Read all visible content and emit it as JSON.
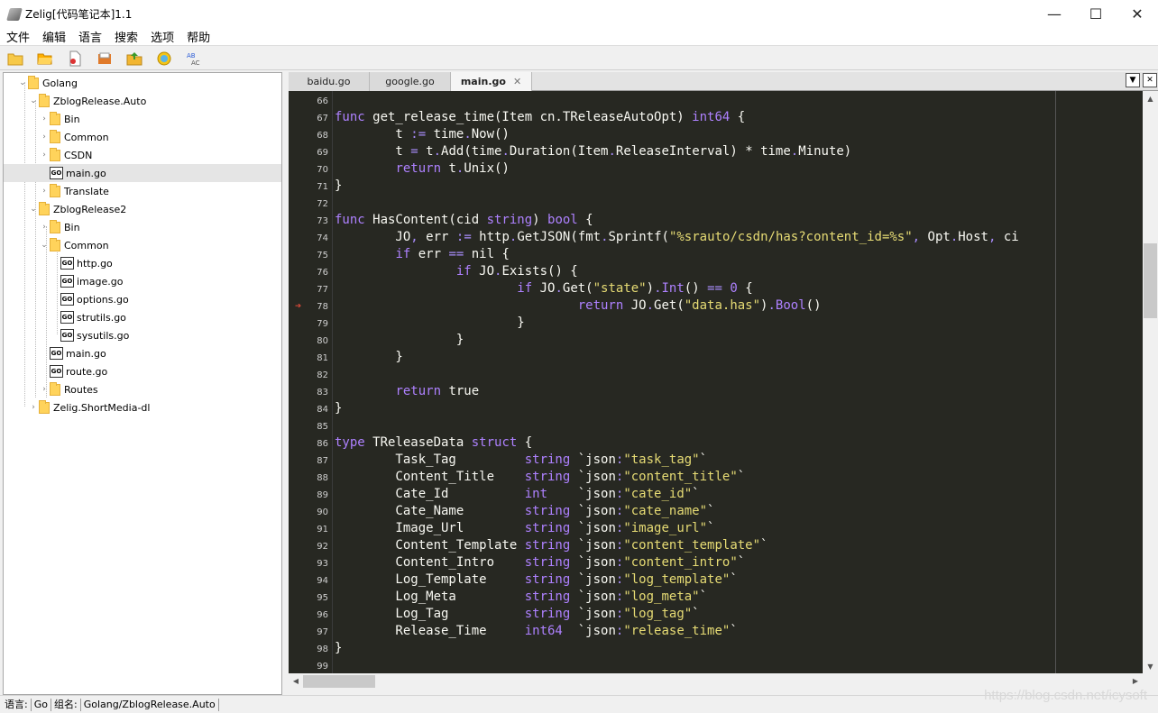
{
  "window": {
    "title": "Zelig[代码笔记本]1.1",
    "minimize": "—",
    "maximize": "☐",
    "close": "✕"
  },
  "menu": [
    "文件",
    "编辑",
    "语言",
    "搜索",
    "选项",
    "帮助"
  ],
  "toolbar_icons": [
    "new-folder-icon",
    "open-folder-icon",
    "document-icon",
    "save-icon",
    "folder-up-icon",
    "settings-icon",
    "spellcheck-icon"
  ],
  "tree": [
    {
      "label": "Golang",
      "icon": "folder",
      "depth": 0,
      "caret": "⌄"
    },
    {
      "label": "ZblogRelease.Auto",
      "icon": "folder",
      "depth": 1,
      "caret": "⌄"
    },
    {
      "label": "Bin",
      "icon": "folder",
      "depth": 2,
      "caret": "›"
    },
    {
      "label": "Common",
      "icon": "folder",
      "depth": 2,
      "caret": "›"
    },
    {
      "label": "CSDN",
      "icon": "folder",
      "depth": 2,
      "caret": "›"
    },
    {
      "label": "main.go",
      "icon": "go",
      "depth": 2,
      "caret": "",
      "selected": true
    },
    {
      "label": "Translate",
      "icon": "folder",
      "depth": 2,
      "caret": "›"
    },
    {
      "label": "ZblogRelease2",
      "icon": "folder",
      "depth": 1,
      "caret": "⌄"
    },
    {
      "label": "Bin",
      "icon": "folder",
      "depth": 2,
      "caret": "›"
    },
    {
      "label": "Common",
      "icon": "folder",
      "depth": 2,
      "caret": "⌄"
    },
    {
      "label": "http.go",
      "icon": "go",
      "depth": 3,
      "caret": ""
    },
    {
      "label": "image.go",
      "icon": "go",
      "depth": 3,
      "caret": ""
    },
    {
      "label": "options.go",
      "icon": "go",
      "depth": 3,
      "caret": ""
    },
    {
      "label": "strutils.go",
      "icon": "go",
      "depth": 3,
      "caret": ""
    },
    {
      "label": "sysutils.go",
      "icon": "go",
      "depth": 3,
      "caret": ""
    },
    {
      "label": "main.go",
      "icon": "go",
      "depth": 2,
      "caret": ""
    },
    {
      "label": "route.go",
      "icon": "go",
      "depth": 2,
      "caret": ""
    },
    {
      "label": "Routes",
      "icon": "folder",
      "depth": 2,
      "caret": "›"
    },
    {
      "label": "Zelig.ShortMedia-dl",
      "icon": "folder",
      "depth": 1,
      "caret": "›"
    }
  ],
  "go_icon_text": "GO",
  "tabs": [
    {
      "label": "baidu.go",
      "active": false
    },
    {
      "label": "google.go",
      "active": false
    },
    {
      "label": "main.go",
      "active": true,
      "close": "✕"
    }
  ],
  "tab_controls": {
    "dropdown": "▼",
    "close": "✕"
  },
  "breakpoint_arrow": "➔",
  "code": [
    {
      "n": "66",
      "t": [
        {
          "c": ""
        }
      ]
    },
    {
      "n": "67",
      "t": [
        {
          "k": "kw",
          "c": "func"
        },
        {
          "c": " get_release_time(Item cn."
        },
        {
          "c": "TReleaseAutoOpt) "
        },
        {
          "k": "kw",
          "c": "int64"
        },
        {
          "c": " {"
        }
      ]
    },
    {
      "n": "68",
      "t": [
        {
          "c": "        t "
        },
        {
          "k": "op",
          "c": ":="
        },
        {
          "c": " time"
        },
        {
          "k": "op",
          "c": "."
        },
        {
          "c": "Now()"
        }
      ]
    },
    {
      "n": "69",
      "t": [
        {
          "c": "        t "
        },
        {
          "k": "op",
          "c": "="
        },
        {
          "c": " t"
        },
        {
          "k": "op",
          "c": "."
        },
        {
          "c": "Add(time"
        },
        {
          "k": "op",
          "c": "."
        },
        {
          "c": "Duration(Item"
        },
        {
          "k": "op",
          "c": "."
        },
        {
          "c": "ReleaseInterval) * time"
        },
        {
          "k": "op",
          "c": "."
        },
        {
          "c": "Minute)"
        }
      ]
    },
    {
      "n": "70",
      "t": [
        {
          "c": "        "
        },
        {
          "k": "kw",
          "c": "return"
        },
        {
          "c": " t"
        },
        {
          "k": "op",
          "c": "."
        },
        {
          "c": "Unix()"
        }
      ]
    },
    {
      "n": "71",
      "t": [
        {
          "c": "}"
        }
      ]
    },
    {
      "n": "72",
      "t": [
        {
          "c": ""
        }
      ]
    },
    {
      "n": "73",
      "t": [
        {
          "k": "kw",
          "c": "func"
        },
        {
          "c": " HasContent(cid "
        },
        {
          "k": "kw",
          "c": "string"
        },
        {
          "c": ") "
        },
        {
          "k": "kw",
          "c": "bool"
        },
        {
          "c": " {"
        }
      ]
    },
    {
      "n": "74",
      "t": [
        {
          "c": "        JO"
        },
        {
          "k": "op",
          "c": ","
        },
        {
          "c": " err "
        },
        {
          "k": "op",
          "c": ":="
        },
        {
          "c": " http"
        },
        {
          "k": "op",
          "c": "."
        },
        {
          "c": "GetJSON(fmt"
        },
        {
          "k": "op",
          "c": "."
        },
        {
          "c": "Sprintf("
        },
        {
          "k": "str",
          "c": "\"%srauto/csdn/has?content_id=%s\""
        },
        {
          "k": "op",
          "c": ","
        },
        {
          "c": " Opt"
        },
        {
          "k": "op",
          "c": "."
        },
        {
          "c": "Host"
        },
        {
          "k": "op",
          "c": ","
        },
        {
          "c": " ci"
        }
      ]
    },
    {
      "n": "75",
      "t": [
        {
          "c": "        "
        },
        {
          "k": "kw",
          "c": "if"
        },
        {
          "c": " err "
        },
        {
          "k": "op",
          "c": "=="
        },
        {
          "c": " nil {"
        }
      ]
    },
    {
      "n": "76",
      "t": [
        {
          "c": "                "
        },
        {
          "k": "kw",
          "c": "if"
        },
        {
          "c": " JO"
        },
        {
          "k": "op",
          "c": "."
        },
        {
          "c": "Exists() {"
        }
      ]
    },
    {
      "n": "77",
      "t": [
        {
          "c": "                        "
        },
        {
          "k": "kw",
          "c": "if"
        },
        {
          "c": " JO"
        },
        {
          "k": "op",
          "c": "."
        },
        {
          "c": "Get("
        },
        {
          "k": "str",
          "c": "\"state\""
        },
        {
          "c": ")"
        },
        {
          "k": "op",
          "c": "."
        },
        {
          "k": "kw",
          "c": "Int"
        },
        {
          "c": "() "
        },
        {
          "k": "op",
          "c": "=="
        },
        {
          "c": " "
        },
        {
          "k": "kw",
          "c": "0"
        },
        {
          "c": " {"
        }
      ]
    },
    {
      "n": "78",
      "t": [
        {
          "c": "                                "
        },
        {
          "k": "kw",
          "c": "return"
        },
        {
          "c": " JO"
        },
        {
          "k": "op",
          "c": "."
        },
        {
          "c": "Get("
        },
        {
          "k": "str",
          "c": "\"data.has\""
        },
        {
          "c": ")"
        },
        {
          "k": "op",
          "c": "."
        },
        {
          "k": "kw",
          "c": "Bool"
        },
        {
          "c": "()"
        }
      ],
      "arrow": true
    },
    {
      "n": "79",
      "t": [
        {
          "c": "                        }"
        }
      ]
    },
    {
      "n": "80",
      "t": [
        {
          "c": "                }"
        }
      ]
    },
    {
      "n": "81",
      "t": [
        {
          "c": "        }"
        }
      ]
    },
    {
      "n": "82",
      "t": [
        {
          "c": ""
        }
      ]
    },
    {
      "n": "83",
      "t": [
        {
          "c": "        "
        },
        {
          "k": "kw",
          "c": "return"
        },
        {
          "c": " true"
        }
      ]
    },
    {
      "n": "84",
      "t": [
        {
          "c": "}"
        }
      ]
    },
    {
      "n": "85",
      "t": [
        {
          "c": ""
        }
      ]
    },
    {
      "n": "86",
      "t": [
        {
          "k": "kw",
          "c": "type"
        },
        {
          "c": " TReleaseData "
        },
        {
          "k": "kw",
          "c": "struct"
        },
        {
          "c": " {"
        }
      ]
    },
    {
      "n": "87",
      "t": [
        {
          "c": "        Task_Tag         "
        },
        {
          "k": "kw",
          "c": "string"
        },
        {
          "c": " `json"
        },
        {
          "k": "op",
          "c": ":"
        },
        {
          "k": "str",
          "c": "\"task_tag\""
        },
        {
          "c": "`"
        }
      ]
    },
    {
      "n": "88",
      "t": [
        {
          "c": "        Content_Title    "
        },
        {
          "k": "kw",
          "c": "string"
        },
        {
          "c": " `json"
        },
        {
          "k": "op",
          "c": ":"
        },
        {
          "k": "str",
          "c": "\"content_title\""
        },
        {
          "c": "`"
        }
      ]
    },
    {
      "n": "89",
      "t": [
        {
          "c": "        Cate_Id          "
        },
        {
          "k": "kw",
          "c": "int"
        },
        {
          "c": "    `json"
        },
        {
          "k": "op",
          "c": ":"
        },
        {
          "k": "str",
          "c": "\"cate_id\""
        },
        {
          "c": "`"
        }
      ]
    },
    {
      "n": "90",
      "t": [
        {
          "c": "        Cate_Name        "
        },
        {
          "k": "kw",
          "c": "string"
        },
        {
          "c": " `json"
        },
        {
          "k": "op",
          "c": ":"
        },
        {
          "k": "str",
          "c": "\"cate_name\""
        },
        {
          "c": "`"
        }
      ]
    },
    {
      "n": "91",
      "t": [
        {
          "c": "        Image_Url        "
        },
        {
          "k": "kw",
          "c": "string"
        },
        {
          "c": " `json"
        },
        {
          "k": "op",
          "c": ":"
        },
        {
          "k": "str",
          "c": "\"image_url\""
        },
        {
          "c": "`"
        }
      ]
    },
    {
      "n": "92",
      "t": [
        {
          "c": "        Content_Template "
        },
        {
          "k": "kw",
          "c": "string"
        },
        {
          "c": " `json"
        },
        {
          "k": "op",
          "c": ":"
        },
        {
          "k": "str",
          "c": "\"content_template\""
        },
        {
          "c": "`"
        }
      ]
    },
    {
      "n": "93",
      "t": [
        {
          "c": "        Content_Intro    "
        },
        {
          "k": "kw",
          "c": "string"
        },
        {
          "c": " `json"
        },
        {
          "k": "op",
          "c": ":"
        },
        {
          "k": "str",
          "c": "\"content_intro\""
        },
        {
          "c": "`"
        }
      ]
    },
    {
      "n": "94",
      "t": [
        {
          "c": "        Log_Template     "
        },
        {
          "k": "kw",
          "c": "string"
        },
        {
          "c": " `json"
        },
        {
          "k": "op",
          "c": ":"
        },
        {
          "k": "str",
          "c": "\"log_template\""
        },
        {
          "c": "`"
        }
      ]
    },
    {
      "n": "95",
      "t": [
        {
          "c": "        Log_Meta         "
        },
        {
          "k": "kw",
          "c": "string"
        },
        {
          "c": " `json"
        },
        {
          "k": "op",
          "c": ":"
        },
        {
          "k": "str",
          "c": "\"log_meta\""
        },
        {
          "c": "`"
        }
      ]
    },
    {
      "n": "96",
      "t": [
        {
          "c": "        Log_Tag          "
        },
        {
          "k": "kw",
          "c": "string"
        },
        {
          "c": " `json"
        },
        {
          "k": "op",
          "c": ":"
        },
        {
          "k": "str",
          "c": "\"log_tag\""
        },
        {
          "c": "`"
        }
      ]
    },
    {
      "n": "97",
      "t": [
        {
          "c": "        Release_Time     "
        },
        {
          "k": "kw",
          "c": "int64"
        },
        {
          "c": "  `json"
        },
        {
          "k": "op",
          "c": ":"
        },
        {
          "k": "str",
          "c": "\"release_time\""
        },
        {
          "c": "`"
        }
      ]
    },
    {
      "n": "98",
      "t": [
        {
          "c": "}"
        }
      ]
    },
    {
      "n": "99",
      "t": [
        {
          "c": ""
        }
      ]
    }
  ],
  "scroll": {
    "up": "▲",
    "down": "▼",
    "left": "◀",
    "right": "▶"
  },
  "status": {
    "lang_label": "语言:",
    "lang_value": "Go",
    "group_label": "组名:",
    "group_value": "Golang/ZblogRelease.Auto"
  },
  "watermark": "https://blog.csdn.net/icysoft",
  "colors": {
    "editor_bg": "#272822",
    "keyword": "#ae81ff",
    "string": "#e6db74",
    "text": "#f8f8f2"
  }
}
